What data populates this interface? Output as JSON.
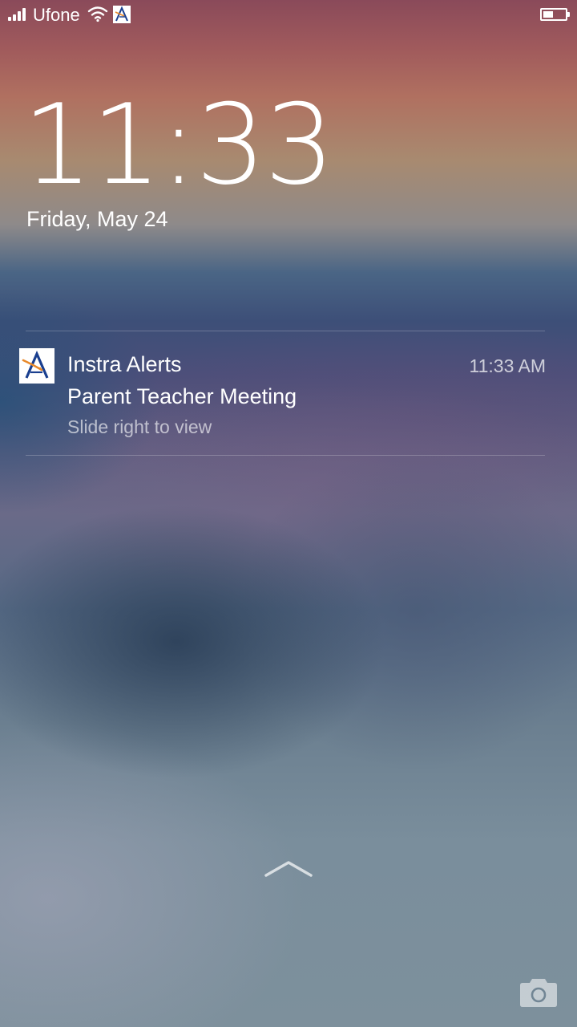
{
  "status_bar": {
    "carrier": "Ufone",
    "signal_icon": "signal-bars-icon",
    "wifi_icon": "wifi-icon",
    "notification_app_icon": "instra-alerts-icon",
    "battery_icon": "battery-icon",
    "battery_level": 0.4
  },
  "lock_screen": {
    "time": "11:33",
    "date": "Friday, May 24"
  },
  "notification": {
    "app_name": "Instra Alerts",
    "time": "11:33 AM",
    "title": "Parent Teacher Meeting",
    "subtitle": "Slide right to view",
    "icon": "instra-alerts-icon"
  },
  "bottom": {
    "unlock_icon": "chevron-up-icon",
    "camera_icon": "camera-icon"
  },
  "colors": {
    "text": "#ffffff",
    "brand_blue": "#1a3f8f",
    "brand_orange": "#e8892a"
  }
}
